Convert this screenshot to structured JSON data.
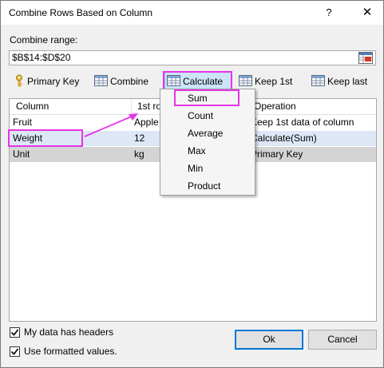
{
  "window": {
    "title": "Combine Rows Based on Column",
    "help": "?",
    "close": "✕"
  },
  "range": {
    "label": "Combine range:",
    "value": "$B$14:$D$20"
  },
  "toolbar": {
    "primary_key": "Primary Key",
    "combine": "Combine",
    "calculate": "Calculate",
    "keep_first": "Keep 1st",
    "keep_last": "Keep last"
  },
  "grid": {
    "headers": [
      "Column",
      "1st ro",
      "Operation"
    ],
    "rows": [
      {
        "column": "Fruit",
        "value": "Apple",
        "operation": "Keep 1st data of column"
      },
      {
        "column": "Weight",
        "value": "12",
        "operation": "Calculate(Sum)"
      },
      {
        "column": "Unit",
        "value": "kg",
        "operation": "Primary Key"
      }
    ]
  },
  "menu": {
    "items": [
      "Sum",
      "Count",
      "Average",
      "Max",
      "Min",
      "Product"
    ]
  },
  "options": {
    "headers_label": "My data has headers",
    "headers_checked": true,
    "formatted_label": "Use formatted values.",
    "formatted_checked": true
  },
  "buttons": {
    "ok": "Ok",
    "cancel": "Cancel"
  },
  "colors": {
    "highlight": "#e634e6",
    "selection": "#dde7f5",
    "accent": "#0078d7"
  }
}
